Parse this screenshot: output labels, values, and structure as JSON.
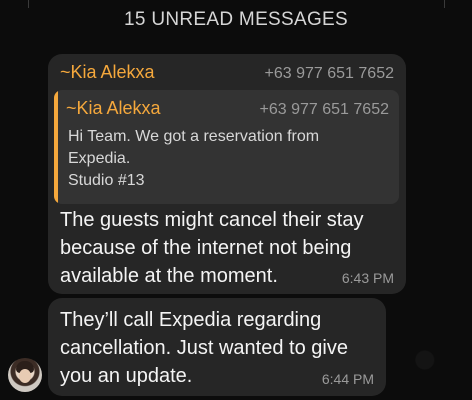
{
  "banner": {
    "unread_label": "15 UNREAD MESSAGES"
  },
  "messages": [
    {
      "sender_name": "~Kia Alekxa",
      "sender_phone": "+63 977 651 7652",
      "quoted": {
        "sender_name": "~Kia Alekxa",
        "sender_phone": "+63 977 651 7652",
        "lines": [
          "Hi Team. We got a reservation from",
          "Expedia.",
          "Studio #13"
        ]
      },
      "lines": [
        "The guests might cancel their stay",
        "because of the internet not being",
        "available at the moment."
      ],
      "time": "6:43 PM"
    },
    {
      "lines": [
        "They’ll call Expedia regarding",
        "cancellation. Just wanted to give",
        "you an update."
      ],
      "time": "6:44 PM"
    }
  ],
  "colors": {
    "sender_accent": "#f5a83c",
    "bubble_bg": "#262626",
    "quote_bg": "#333333",
    "background": "#0c0c0c"
  }
}
